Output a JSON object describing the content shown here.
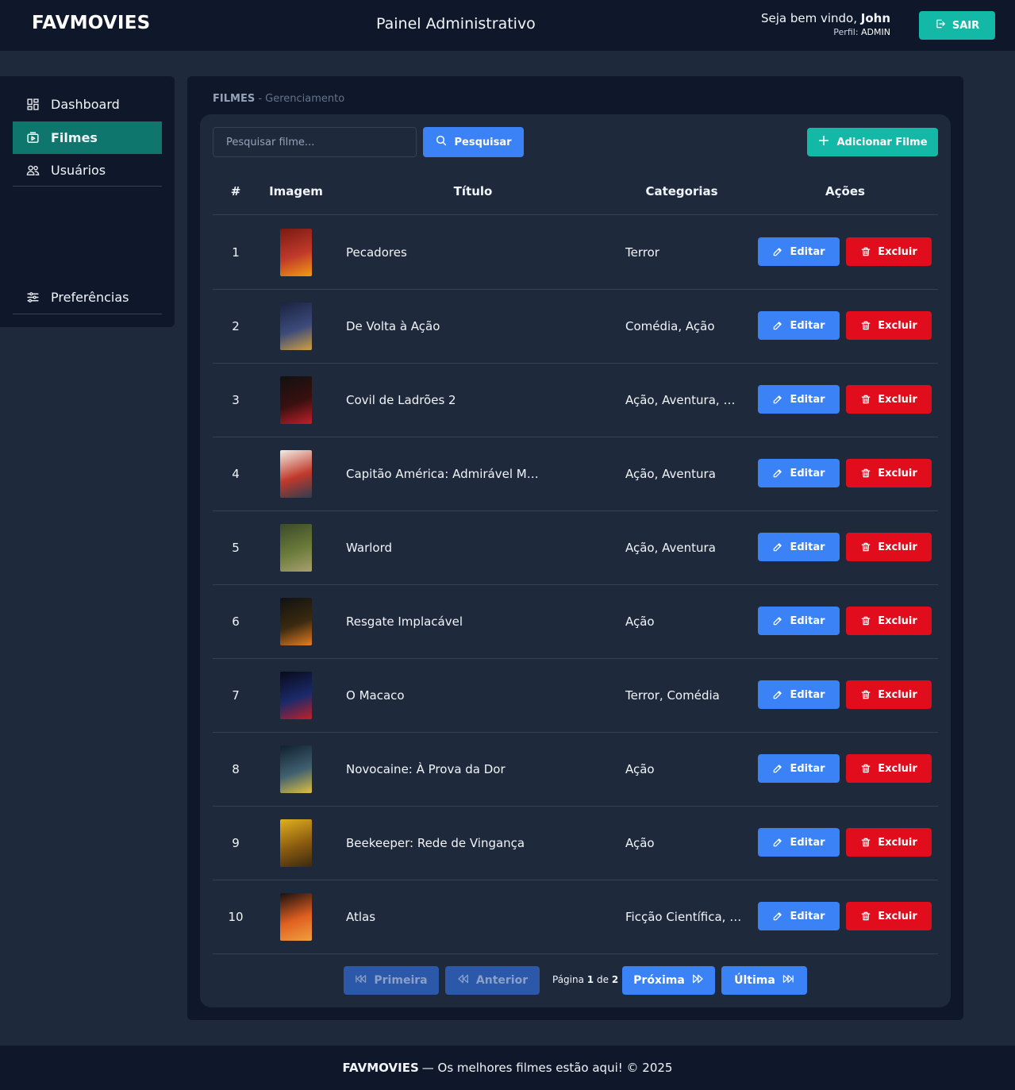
{
  "header": {
    "brand": "FAVMOVIES",
    "panel_title": "Painel Administrativo",
    "welcome_prefix": "Seja bem vindo,",
    "user_name": "John",
    "profile_label": "Perfil:",
    "profile_value": "ADMIN",
    "logout_label": "SAIR"
  },
  "sidebar": {
    "items": [
      {
        "label": "Dashboard",
        "icon": "dashboard-icon",
        "active": false
      },
      {
        "label": "Filmes",
        "icon": "film-icon",
        "active": true
      },
      {
        "label": "Usuários",
        "icon": "users-icon",
        "active": false
      }
    ],
    "preferences_label": "Preferências"
  },
  "breadcrumb": {
    "section": "FILMES",
    "separator": " - ",
    "sub": "Gerenciamento"
  },
  "toolbar": {
    "search_placeholder": "Pesquisar filme...",
    "search_label": "Pesquisar",
    "add_label": "Adicionar Filme"
  },
  "table": {
    "headers": [
      "#",
      "Imagem",
      "Título",
      "Categorias",
      "Ações"
    ],
    "edit_label": "Editar",
    "delete_label": "Excluir",
    "rows": [
      {
        "num": "1",
        "title": "Pecadores",
        "categories": "Terror",
        "poster_colors": [
          "#7a1a12",
          "#c0392b",
          "#f39c12"
        ]
      },
      {
        "num": "2",
        "title": "De Volta à Ação",
        "categories": "Comédia, Ação",
        "poster_colors": [
          "#1c2340",
          "#3b4a7a",
          "#d0a040"
        ]
      },
      {
        "num": "3",
        "title": "Covil de Ladrões 2",
        "categories": "Ação, Aventura, Drama",
        "poster_colors": [
          "#111111",
          "#3a1010",
          "#c0202a"
        ]
      },
      {
        "num": "4",
        "title": "Capitão América: Admirável Mundo Novo",
        "categories": "Ação, Aventura",
        "poster_colors": [
          "#f3eee4",
          "#c0392b",
          "#2c3e50"
        ]
      },
      {
        "num": "5",
        "title": "Warlord",
        "categories": "Ação, Aventura",
        "poster_colors": [
          "#3c4a2a",
          "#6b7b3a",
          "#a8a070"
        ]
      },
      {
        "num": "6",
        "title": "Resgate Implacável",
        "categories": "Ação",
        "poster_colors": [
          "#111111",
          "#3a2a10",
          "#e67e22"
        ]
      },
      {
        "num": "7",
        "title": "O Macaco",
        "categories": "Terror, Comédia",
        "poster_colors": [
          "#0a0a1a",
          "#1a2a6a",
          "#c0202a"
        ]
      },
      {
        "num": "8",
        "title": "Novocaine: À Prova da Dor",
        "categories": "Ação",
        "poster_colors": [
          "#102030",
          "#406070",
          "#e0c040"
        ]
      },
      {
        "num": "9",
        "title": "Beekeeper: Rede de Vingança",
        "categories": "Ação",
        "poster_colors": [
          "#e0b020",
          "#8a5a10",
          "#3a2a10"
        ]
      },
      {
        "num": "10",
        "title": "Atlas",
        "categories": "Ficção Científica, Ação",
        "poster_colors": [
          "#1a1010",
          "#e06020",
          "#f0a040"
        ]
      }
    ]
  },
  "pagination": {
    "first_label": "Primeira",
    "prev_label": "Anterior",
    "page_word": "Página",
    "current_page": "1",
    "of_word": "de",
    "total_pages": "2",
    "next_label": "Próxima",
    "last_label": "Última"
  },
  "footer": {
    "brand": "FAVMOVIES",
    "text": "— Os melhores filmes estão aqui! © 2025"
  },
  "colors": {
    "accent_teal": "#14b8a6",
    "active_nav": "#0f766e",
    "primary_blue": "#3b82f6",
    "danger_red": "#e10c1c",
    "background": "#1e293b",
    "panel": "#0f172a"
  }
}
